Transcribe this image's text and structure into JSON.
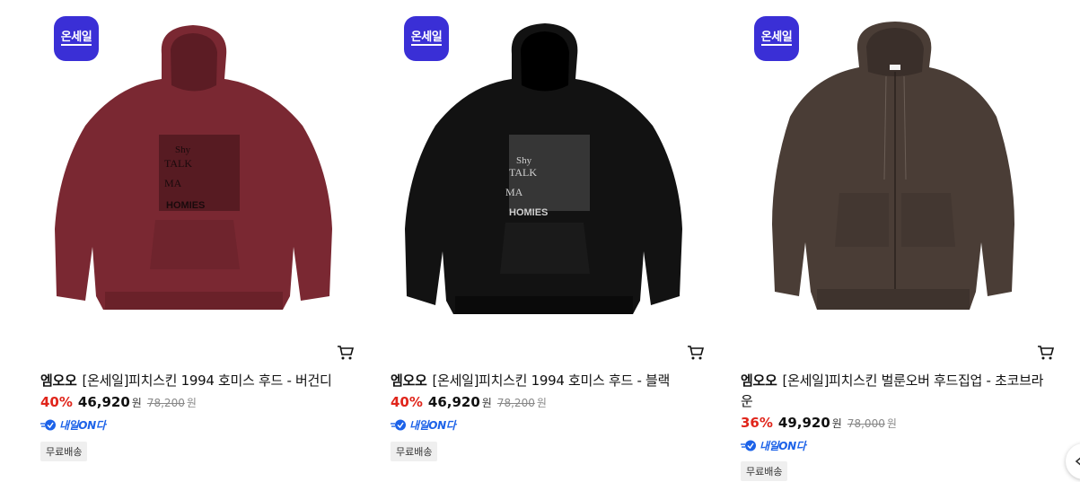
{
  "products": [
    {
      "badge": "온세일",
      "brand": "엠오오",
      "name": "[온세일]피치스킨 1994 호미스 후드 - 버건디",
      "discount": "40%",
      "sale_price": "46,920",
      "currency": "원",
      "original_price": "78,200",
      "delivery_label": "내일ON다",
      "shipping_badge": "무료배송",
      "hoodie_color": "#7a2832"
    },
    {
      "badge": "온세일",
      "brand": "엠오오",
      "name": "[온세일]피치스킨 1994 호미스 후드 - 블랙",
      "discount": "40%",
      "sale_price": "46,920",
      "currency": "원",
      "original_price": "78,200",
      "delivery_label": "내일ON다",
      "shipping_badge": "무료배송",
      "hoodie_color": "#121212"
    },
    {
      "badge": "온세일",
      "brand": "엠오오",
      "name": "[온세일]피치스킨 벌룬오버 후드집업 - 초코브라운",
      "discount": "36%",
      "sale_price": "49,920",
      "currency": "원",
      "original_price": "78,000",
      "delivery_label": "내일ON다",
      "shipping_badge": "무료배송",
      "hoodie_color": "#4a3d36"
    }
  ],
  "colors": {
    "badge_bg": "#3a2fd6",
    "discount": "#e0251b",
    "delivery": "#1c62e8"
  }
}
